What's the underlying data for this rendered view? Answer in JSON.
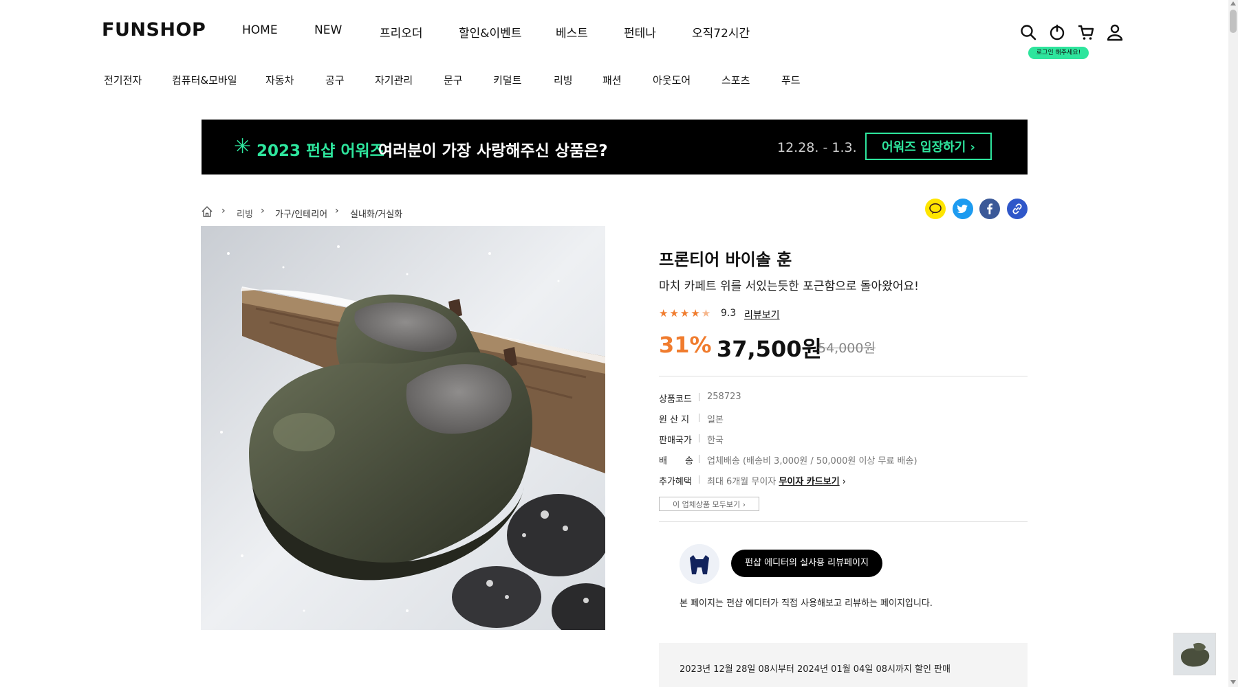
{
  "header": {
    "logo": "FUNSHOP",
    "nav": [
      "HOME",
      "NEW",
      "프리오더",
      "할인&이벤트",
      "베스트",
      "펀테나",
      "오직72시간"
    ],
    "icons": [
      "search-icon",
      "power-icon",
      "cart-icon",
      "user-icon"
    ],
    "login_badge": "로그인 해주세요!",
    "categories": [
      "전기전자",
      "컴퓨터&모바일",
      "자동차",
      "공구",
      "자기관리",
      "문구",
      "키덜트",
      "리빙",
      "패션",
      "아웃도어",
      "스포츠",
      "푸드"
    ]
  },
  "banner": {
    "highlight": "2023 펀샵 어워즈",
    "text": "여러분이 가장 사랑해주신 상품은?",
    "date": "12.28. - 1.3.",
    "button": "어워즈 입장하기 ›"
  },
  "breadcrumb": [
    "리빙",
    "가구/인테리어",
    "실내화/거실화"
  ],
  "share": [
    "kakao-icon",
    "twitter-icon",
    "facebook-icon",
    "link-icon"
  ],
  "product": {
    "title": "프론티어 바이솔 훈",
    "subtitle": "마치 카페트 위를 서있는듯한 포근함으로 돌아왔어요!",
    "rating": 4.5,
    "score": "9.3",
    "review_link": "리뷰보기",
    "discount": "31%",
    "price": "37,500원",
    "original_price": "54,000원",
    "info": [
      {
        "label": "상품코드",
        "value": "258723"
      },
      {
        "label": "원 산 지",
        "value": "일본"
      },
      {
        "label": "판매국가",
        "value": "한국"
      },
      {
        "label": "배　　송",
        "value": "업체배송 (배송비 3,000원 / 50,000원 이상 무료 배송)"
      },
      {
        "label": "추가혜택",
        "value": "최대 6개월 무이자",
        "link": "무이자 카드보기"
      }
    ],
    "vendor_button": "이 업체상품 모두보기 ›",
    "editor_button": "펀샵 에디터의 실사용 리뷰페이지",
    "editor_note": "본 페이지는 펀샵 에디터가 직접 사용해보고 리뷰하는 페이지입니다.",
    "sale_period": "2023년 12월 28일 08시부터 2024년 01월 04일 08시까지 할인 판매"
  },
  "colors": {
    "accent": "#2ee59d",
    "discount": "#f07c2e",
    "banner_bg": "#000000"
  }
}
